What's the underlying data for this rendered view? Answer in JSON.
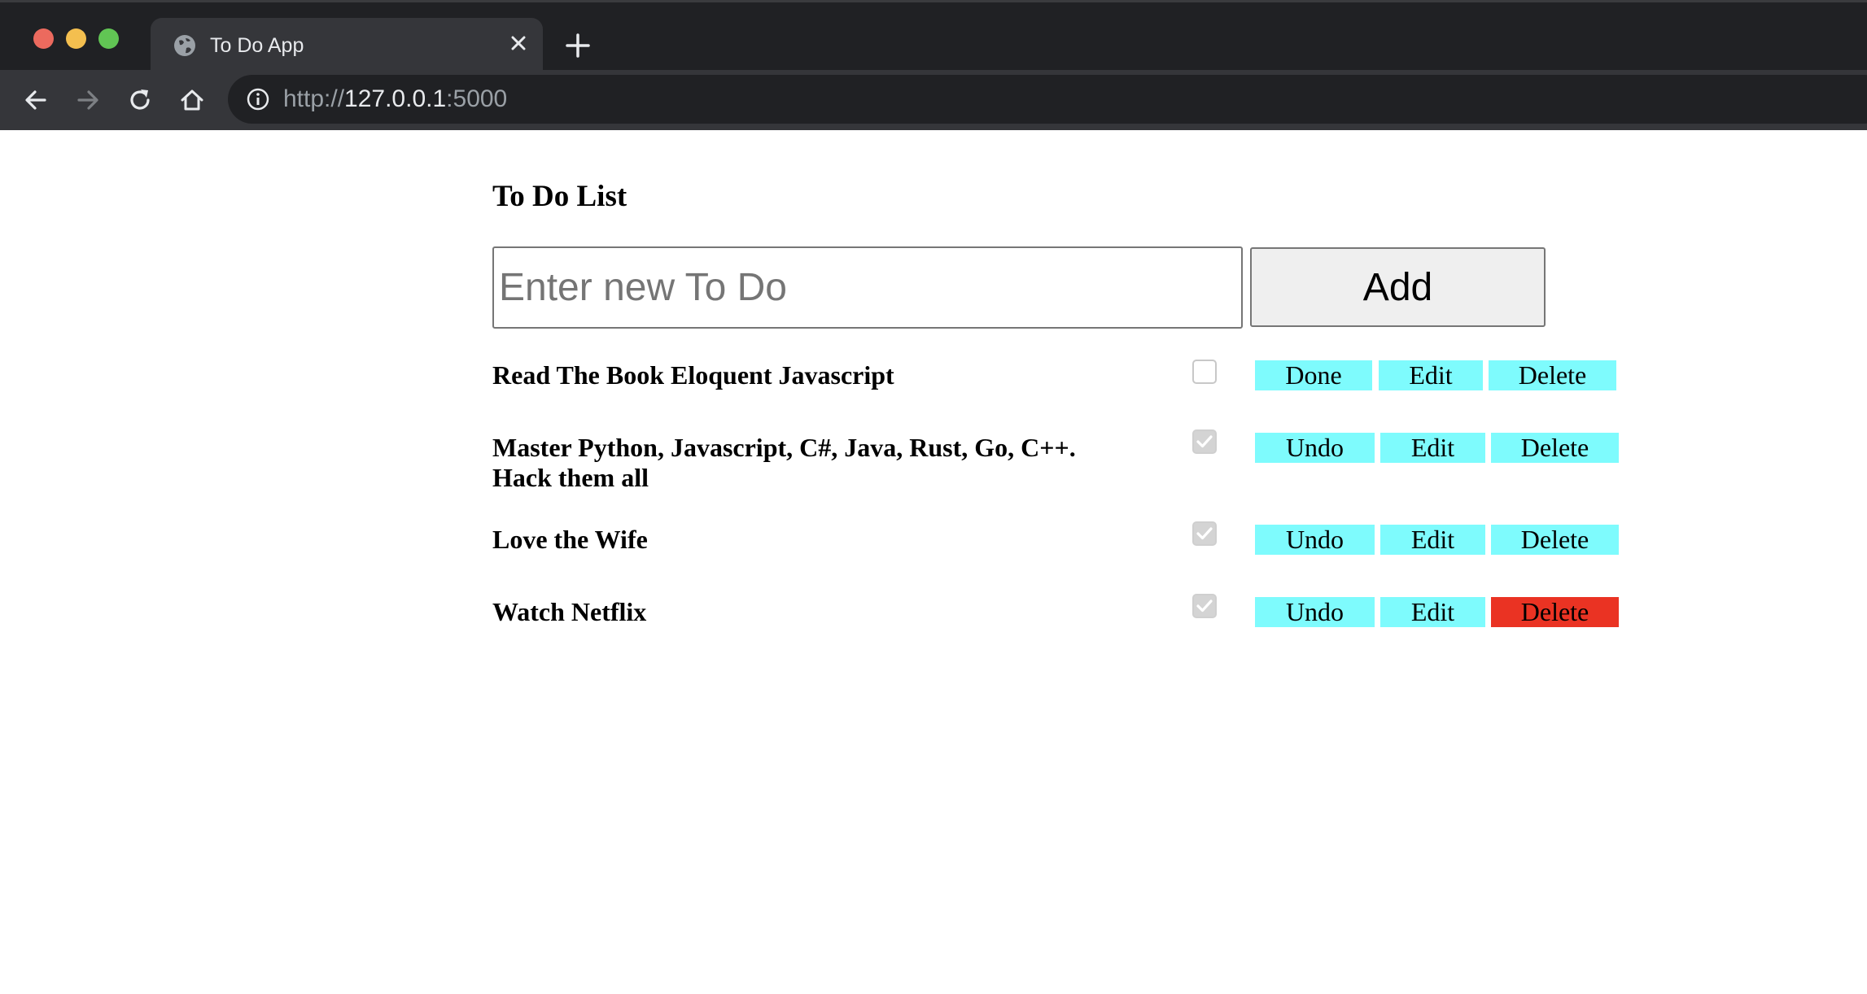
{
  "browser": {
    "tab_title": "To Do App",
    "url_scheme": "http://",
    "url_host": "127.0.0.1",
    "url_port": ":5000"
  },
  "page": {
    "title": "To Do List",
    "input_placeholder": "Enter new To Do",
    "input_value": "",
    "add_label": "Add"
  },
  "todos": [
    {
      "text": "Read The Book Eloquent Javascript",
      "checked": false,
      "toggle_label": "Done",
      "edit_label": "Edit",
      "delete_label": "Delete"
    },
    {
      "text": "Master Python, Javascript, C#, Java, Rust, Go, C++. Hack them all",
      "checked": true,
      "toggle_label": "Undo",
      "edit_label": "Edit",
      "delete_label": "Delete"
    },
    {
      "text": "Love the Wife",
      "checked": true,
      "toggle_label": "Undo",
      "edit_label": "Edit",
      "delete_label": "Delete"
    },
    {
      "text": "Watch Netflix",
      "checked": true,
      "toggle_label": "Undo",
      "edit_label": "Edit",
      "delete_label": "Delete"
    }
  ],
  "colors": {
    "action_button": "#7efbfd",
    "delete_highlight": "#ea3323",
    "browser_dark": "#202124",
    "browser_toolbar": "#35363a"
  },
  "icons": [
    "globe-icon",
    "close-icon",
    "plus-icon",
    "back-arrow-icon",
    "forward-arrow-icon",
    "reload-icon",
    "home-icon",
    "info-icon",
    "checkmark-icon"
  ]
}
